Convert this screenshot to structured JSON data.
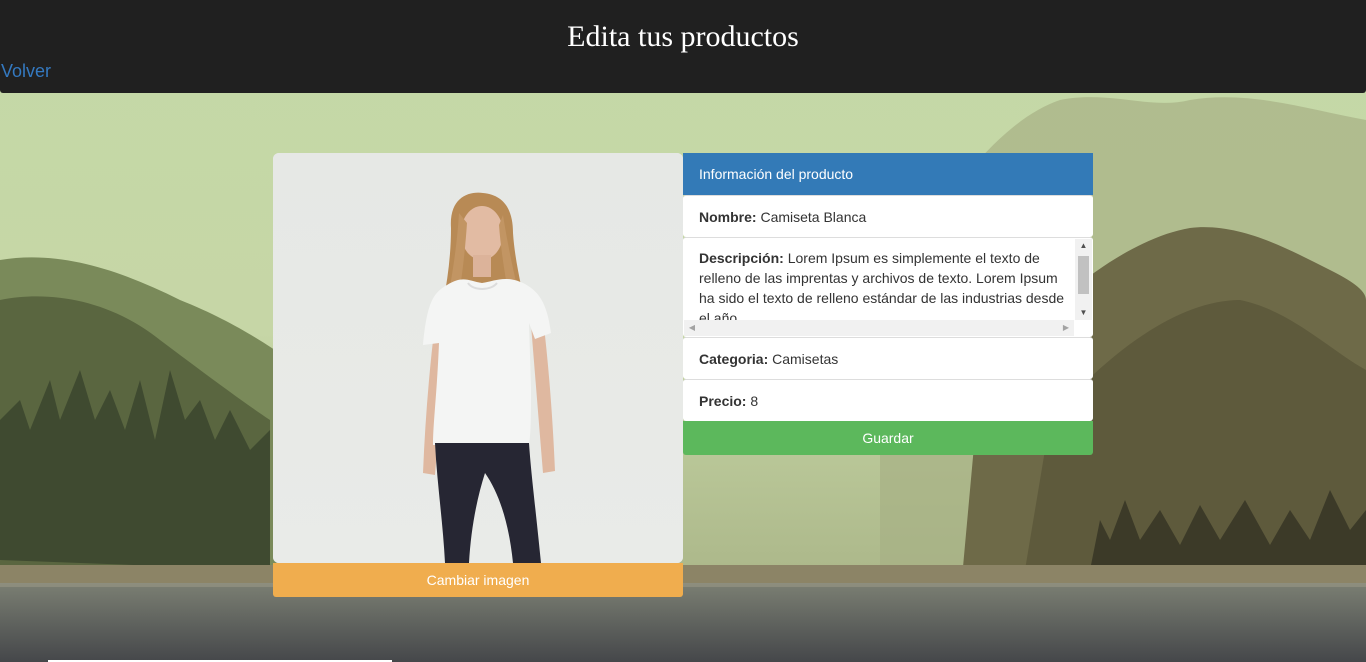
{
  "header": {
    "title": "Edita tus productos",
    "back_link": "Volver"
  },
  "product_image": {
    "change_button": "Cambiar imagen"
  },
  "panel": {
    "heading": "Información del producto",
    "fields": [
      {
        "label": "Nombre:",
        "value": "Camiseta Blanca"
      },
      {
        "label": "Descripción:",
        "value": "Lorem Ipsum es simplemente el texto de relleno de las imprentas y archivos de texto. Lorem Ipsum ha sido el texto de relleno estándar de las industrias desde el año"
      },
      {
        "label": "Categoria:",
        "value": "Camisetas"
      },
      {
        "label": "Precio:",
        "value": "8"
      }
    ],
    "save_button": "Guardar"
  },
  "colors": {
    "header_bg": "#202020",
    "link": "#3479c0",
    "panel_heading": "#337ab7",
    "warning_button": "#f0ad4e",
    "success_button": "#5cb85c"
  },
  "icons": {
    "scroll_up": "triangle-up-icon",
    "scroll_down": "triangle-down-icon",
    "scroll_left": "triangle-left-icon",
    "scroll_right": "triangle-right-icon"
  }
}
